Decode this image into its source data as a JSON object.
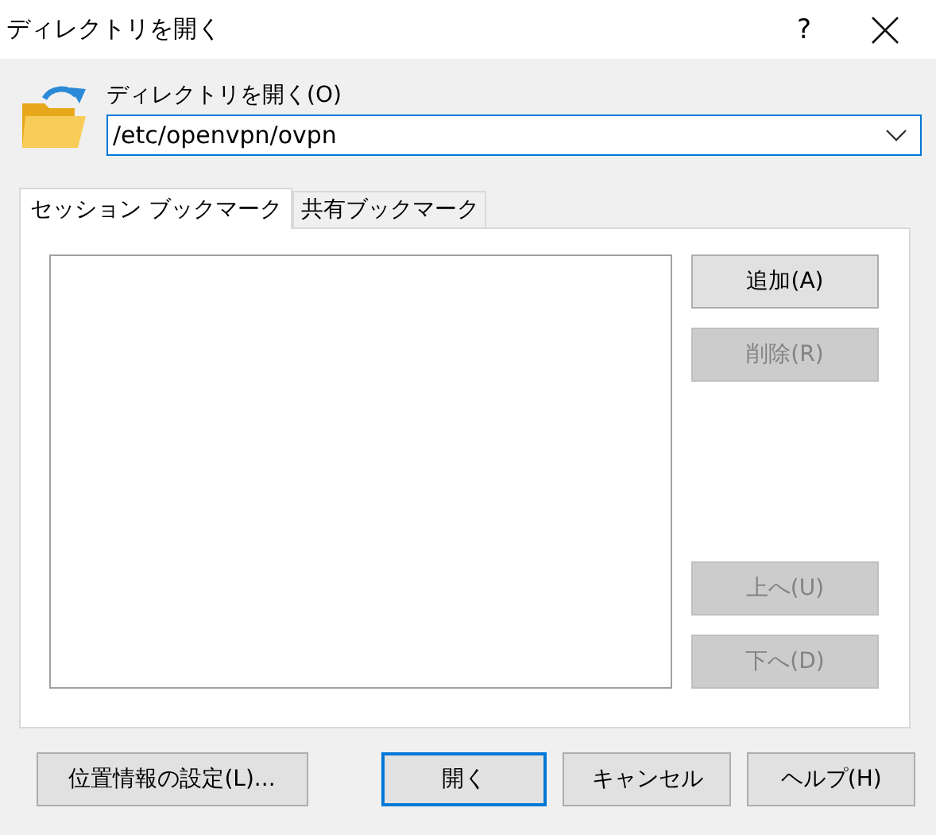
{
  "window": {
    "title": "ディレクトリを開く",
    "help_button": "?"
  },
  "directory": {
    "label": "ディレクトリを開く(O)",
    "value": "/etc/openvpn/ovpn"
  },
  "tabs": [
    {
      "label": "セッション ブックマーク",
      "selected": true
    },
    {
      "label": "共有ブックマーク",
      "selected": false
    }
  ],
  "side_buttons": [
    {
      "label": "追加(A)",
      "disabled": false
    },
    {
      "label": "削除(R)",
      "disabled": true
    },
    {
      "label": "上へ(U)",
      "disabled": true
    },
    {
      "label": "下へ(D)",
      "disabled": true
    }
  ],
  "bottom_buttons": [
    {
      "label": "位置情報の設定(L)...",
      "default": false
    },
    {
      "label": "開く",
      "default": true
    },
    {
      "label": "キャンセル",
      "default": false
    },
    {
      "label": "ヘルプ(H)",
      "default": false
    }
  ]
}
